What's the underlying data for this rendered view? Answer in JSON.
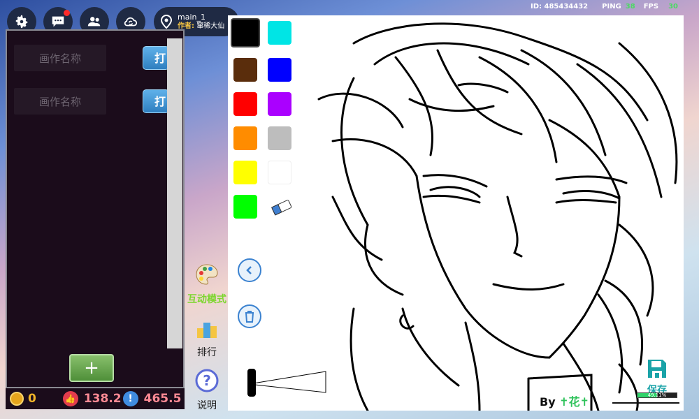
{
  "topbar": {
    "map_title": "main_1",
    "author_label": "作者:",
    "author_name": "窜稀大仙",
    "id_text": "ID: 485434432",
    "ping_label": "PING",
    "ping_value": "38",
    "fps_label": "FPS",
    "fps_value": "30"
  },
  "panel": {
    "items": [
      {
        "placeholder": "画作名称",
        "open_label": "打开"
      },
      {
        "placeholder": "画作名称",
        "open_label": "打开"
      }
    ],
    "add_label": "+"
  },
  "bottom": {
    "coins": "0",
    "likes": "138.2",
    "score": "465.5"
  },
  "side": {
    "interactive_mode": "互动模式",
    "ranking": "排行",
    "help": "说明"
  },
  "palette": [
    "#000000",
    "#00e5e5",
    "#5a2d0c",
    "#0000ff",
    "#ff0000",
    "#aa00ff",
    "#ff8c00",
    "#bdbdbd",
    "#ffff00",
    "#ffffff",
    "#00ff00"
  ],
  "canvas": {
    "by_label": "By",
    "artist": "✝花✝",
    "save_label": "保存",
    "progress_text": "49.11%",
    "progress_value": 49.11
  }
}
